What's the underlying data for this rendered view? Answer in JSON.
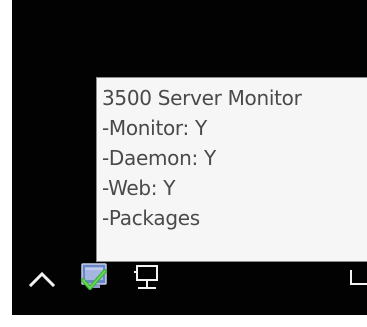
{
  "tooltip": {
    "lines": [
      "3500 Server Monitor",
      "-Monitor: Y",
      "-Daemon: Y",
      "-Web: Y",
      "-Packages"
    ]
  },
  "tray": {
    "icons": [
      "chevron-up-icon",
      "server-monitor-app-icon",
      "network-icon",
      "partial-tray-icon"
    ]
  },
  "colors": {
    "desktop": "#020202",
    "tooltip_background": "#f6f6f6",
    "tooltip_border": "#8d8d8d",
    "tooltip_text": "#4a4a4a",
    "check_green": "#3bb33b"
  }
}
